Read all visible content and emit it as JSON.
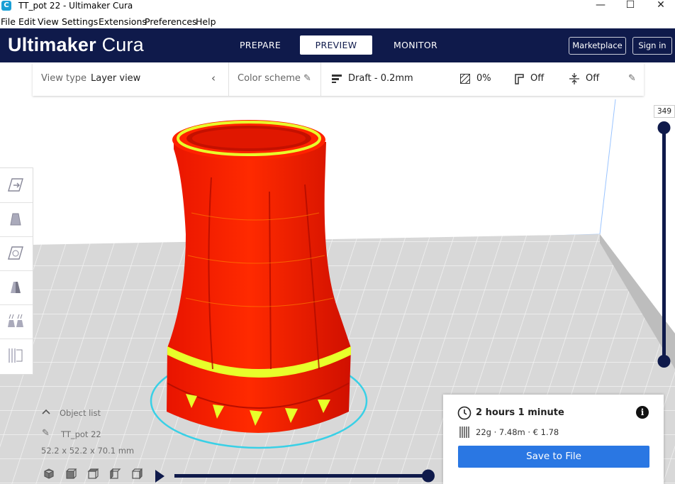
{
  "window": {
    "title": "TT_pot 22 - Ultimaker Cura",
    "app_icon_letter": "C",
    "minimize_glyph": "—",
    "maximize_glyph": "☐",
    "close_glyph": "✕"
  },
  "menu": [
    "File",
    "Edit",
    "View",
    "Settings",
    "Extensions",
    "Preferences",
    "Help"
  ],
  "header": {
    "logo_bold": "Ultimaker",
    "logo_light": "Cura",
    "tabs": [
      "PREPARE",
      "PREVIEW",
      "MONITOR"
    ],
    "active_tab": "PREVIEW",
    "marketplace": "Marketplace",
    "sign_in": "Sign in"
  },
  "toolbar": {
    "view_type_label": "View type",
    "view_type_value": "Layer view",
    "color_scheme_label": "Color scheme",
    "profile": "Draft - 0.2mm",
    "infill": "0%",
    "support": "Off",
    "adhesion": "Off"
  },
  "layer_slider": {
    "value": "349"
  },
  "object": {
    "list_label": "Object list",
    "name": "TT_pot 22",
    "dimensions": "52.2 x 52.2 x 70.1 mm"
  },
  "print": {
    "time": "2 hours 1 minute",
    "material": "22g · 7.48m · € 1.78",
    "save_label": "Save to File"
  },
  "icons": {
    "clock": "clock-icon",
    "info": "info-icon",
    "material": "material-spool-icon",
    "play": "play-icon"
  },
  "colors": {
    "header_bg": "#0f1a4b",
    "accent": "#2a77e3",
    "model_red": "#ff1a00",
    "model_yellow": "#e8ff2a",
    "skirt_cyan": "#39d0e6"
  }
}
